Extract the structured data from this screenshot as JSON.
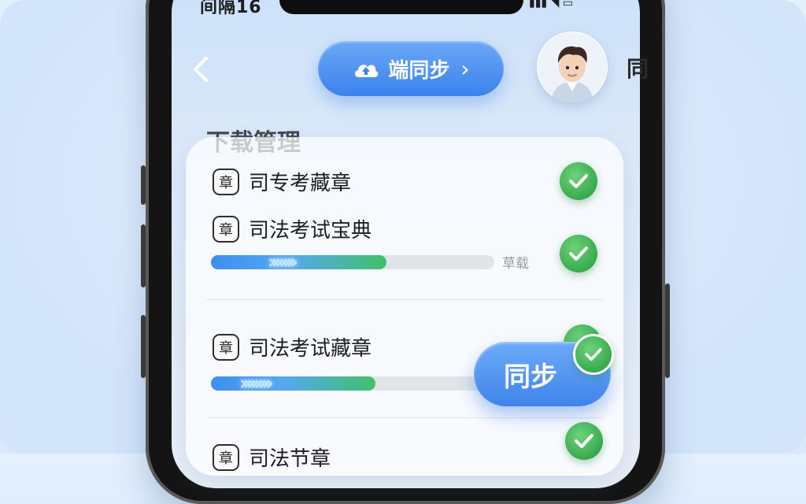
{
  "status_bar": {
    "left_text": "间隔16",
    "right_icons": "▮▮▮ ◥ ▭"
  },
  "header": {
    "back_icon": "chevron-left-icon",
    "sync_pill": {
      "label": "端同步",
      "icon": "cloud-upload-icon",
      "chevron": "›"
    },
    "edge_text": "同"
  },
  "section": {
    "title": "下载管理"
  },
  "items": [
    {
      "title": "司专考藏章",
      "badge": "章",
      "status": "done"
    },
    {
      "title": "司法考试宝典",
      "badge": "章",
      "status": "done",
      "progress": 0.62,
      "progress_label": "草载"
    },
    {
      "title": "司法考试藏章",
      "badge": "章",
      "status": "done",
      "progress": 0.55
    },
    {
      "title": "司法节章",
      "badge": "章",
      "status": "done"
    }
  ],
  "sync_button": {
    "label": "同步"
  },
  "colors": {
    "accent_blue": "#3b82ec",
    "success_green": "#34a84a",
    "bg": "#d3e5fb"
  }
}
